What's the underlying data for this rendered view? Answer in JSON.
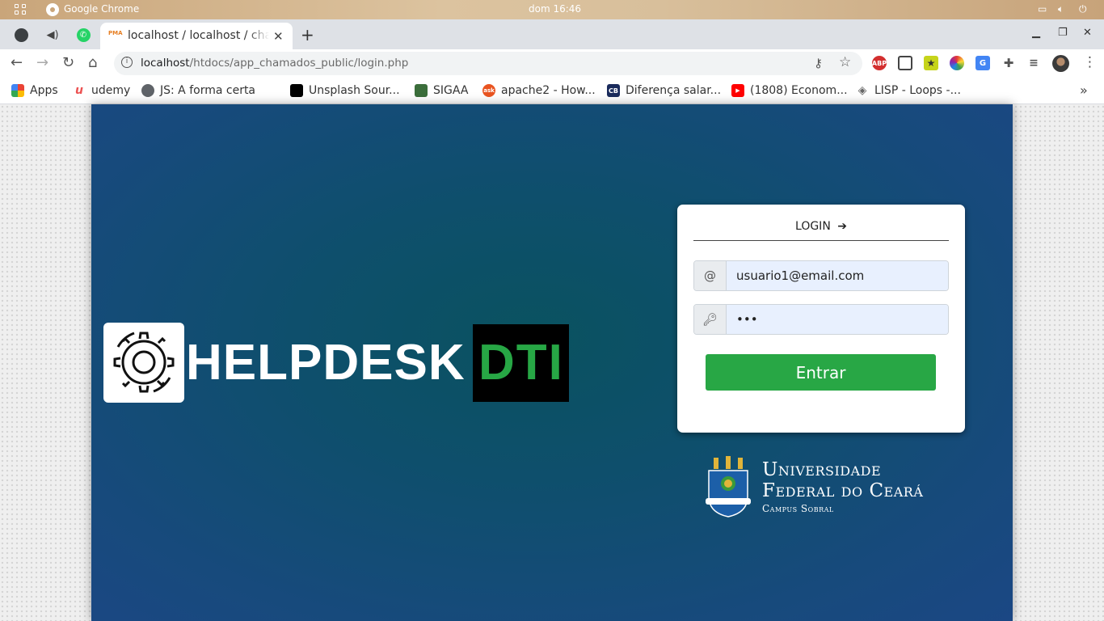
{
  "os": {
    "app_name": "Google Chrome",
    "clock": "dom 16:46"
  },
  "browser": {
    "active_tab_title": "localhost / localhost / chamados",
    "active_tab_favicon": "PMA",
    "url_host": "localhost",
    "url_path": "/htdocs/app_chamados_public/login.php",
    "ext_abp": "ABP"
  },
  "bookmarks": [
    {
      "label": "Apps",
      "icon": "apps-grid",
      "color": "#4285f4"
    },
    {
      "label": "udemy",
      "icon": "udemy-logo",
      "color": "#ec5252"
    },
    {
      "label": "JS: A forma certa",
      "icon": "globe",
      "color": "#5f6368"
    },
    {
      "label": "Unsplash Sour...",
      "icon": "unsplash-logo",
      "color": "#000000"
    },
    {
      "label": "SIGAA",
      "icon": "sigaa-logo",
      "color": "#3b6e3b"
    },
    {
      "label": "apache2 - How...",
      "icon": "askubuntu-logo",
      "color": "#e95420"
    },
    {
      "label": "Diferença salar...",
      "icon": "cb-logo",
      "color": "#1a2b5c"
    },
    {
      "label": "(1808) Econom...",
      "icon": "youtube-logo",
      "color": "#ff0000"
    },
    {
      "label": "LISP - Loops -...",
      "icon": "diamond",
      "color": "#666666"
    }
  ],
  "brand": {
    "helpdesk": "HELPDESK",
    "dti": "DTI"
  },
  "login": {
    "title": "LOGIN",
    "email_addon": "@",
    "email_value": "usuario1@email.com",
    "password_value": "•••",
    "submit_label": "Entrar"
  },
  "ufc": {
    "line1": "Universidade",
    "line2": "Federal do Ceará",
    "line3": "Campus Sobral"
  },
  "colors": {
    "accent_green": "#28a745",
    "dti_green": "#27a745",
    "content_bg": "#0e4f6c"
  }
}
